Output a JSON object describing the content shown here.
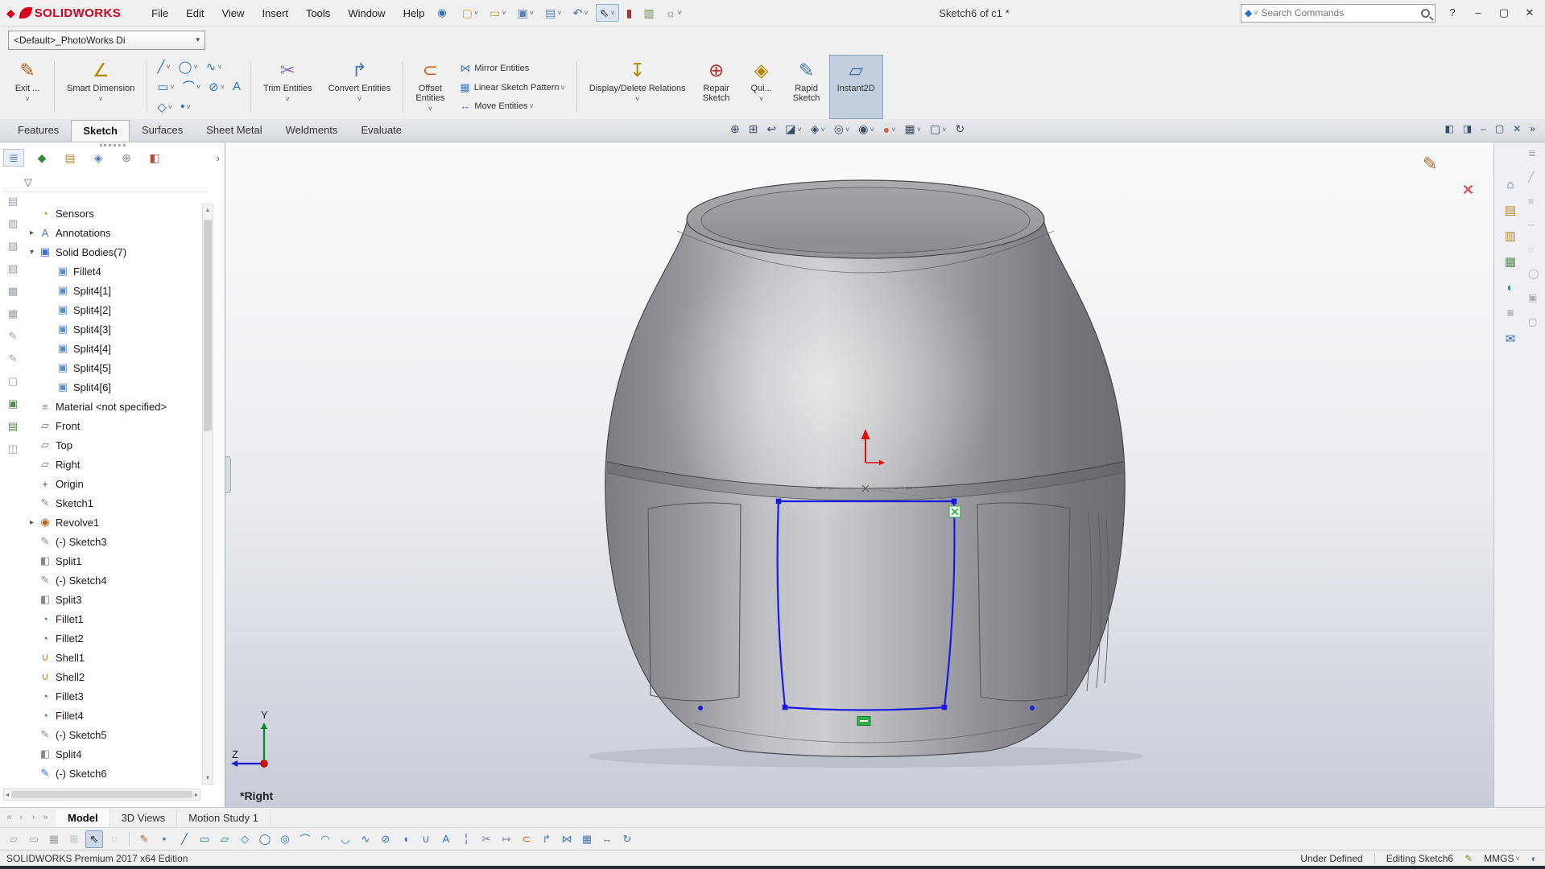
{
  "ui": {
    "caret": "▾",
    "caret_small": "˅",
    "tree_expanded": "▾",
    "tree_collapsed": "▸",
    "scroll_up": "▴",
    "scroll_down": "▾",
    "scroll_left": "◂",
    "scroll_right": "▸",
    "panel_chevron": "›"
  },
  "colors": {
    "logo_red": "#d6001c",
    "sketch_blue": "#1a1ae0",
    "relation_green": "#2fae4a",
    "axis_red": "#e01010",
    "triad_green": "#00882a",
    "triad_blue": "#1a1ad0",
    "active_button_bg": "#c3cfdf",
    "chrome_bg": "#f0f0f0"
  },
  "titlebar": {
    "app_icon": {
      "glyph": "◆",
      "color": "#d6001c"
    },
    "logo_text": "SOLIDWORKS",
    "menus": [
      "File",
      "Edit",
      "View",
      "Insert",
      "Tools",
      "Window",
      "Help"
    ],
    "pin_icon": {
      "glyph": "◉",
      "color": "#2a6fc0"
    },
    "quick_access": [
      {
        "name": "new-document",
        "icon": {
          "glyph": "▢",
          "color": "#c8a23c"
        },
        "caret": true
      },
      {
        "name": "open",
        "icon": {
          "glyph": "▭",
          "color": "#c8a23c"
        },
        "caret": true
      },
      {
        "name": "save",
        "icon": {
          "glyph": "▣",
          "color": "#5b7fae"
        },
        "caret": true
      },
      {
        "name": "print",
        "icon": {
          "glyph": "▤",
          "color": "#5b7fae"
        },
        "caret": true
      },
      {
        "name": "undo",
        "icon": {
          "glyph": "↶",
          "color": "#3a6eb5"
        },
        "caret": true
      },
      {
        "name": "select",
        "icon": {
          "glyph": "⇖",
          "color": "#333333"
        },
        "caret": true,
        "active": true
      },
      {
        "name": "rebuild",
        "icon": {
          "glyph": "▮",
          "color": "#b03030"
        }
      },
      {
        "name": "file-properties",
        "icon": {
          "glyph": "▥",
          "color": "#6a8a4a"
        }
      },
      {
        "name": "options",
        "icon": {
          "glyph": "☼",
          "color": "#777777"
        },
        "caret": true
      }
    ],
    "document_title": "Sketch6 of c1 *",
    "search": {
      "selector_icon": {
        "glyph": "◆",
        "color": "#2a6fc0"
      },
      "placeholder": "Search Commands"
    },
    "window_controls": [
      {
        "name": "help",
        "glyph": "?"
      },
      {
        "name": "minimize",
        "glyph": "–"
      },
      {
        "name": "maximize",
        "glyph": "▢"
      },
      {
        "name": "close",
        "glyph": "✕"
      }
    ]
  },
  "config_bar": {
    "value": "<Default>_PhotoWorks Di"
  },
  "ribbon": {
    "tabs": [
      {
        "label": "Features"
      },
      {
        "label": "Sketch",
        "active": true
      },
      {
        "label": "Surfaces"
      },
      {
        "label": "Sheet Metal"
      },
      {
        "label": "Weldments"
      },
      {
        "label": "Evaluate"
      }
    ],
    "exit_sketch": {
      "label": "Exit ...",
      "icon": {
        "glyph": "✎",
        "color": "#b5651d"
      }
    },
    "smart_dimension": {
      "label": "Smart Dimension",
      "icon": {
        "glyph": "∠",
        "color": "#b08800"
      }
    },
    "sketch_tools_grid": [
      [
        {
          "name": "line",
          "glyph": "╱",
          "caret": true
        },
        {
          "name": "circle",
          "glyph": "◯",
          "caret": true
        },
        {
          "name": "spline",
          "glyph": "∿",
          "caret": true
        }
      ],
      [
        {
          "name": "corner-rectangle",
          "glyph": "▭",
          "caret": true
        },
        {
          "name": "centerpoint-arc",
          "glyph": "⌒",
          "caret": true
        },
        {
          "name": "ellipse",
          "glyph": "⊘",
          "caret": true
        },
        {
          "name": "text",
          "glyph": "A"
        }
      ],
      [
        {
          "name": "polygon",
          "glyph": "◇",
          "caret": true
        },
        {
          "name": "point",
          "glyph": "•",
          "caret": true
        }
      ]
    ],
    "trim_entities": {
      "label": "Trim Entities",
      "icon": {
        "glyph": "✂",
        "color": "#8a6db0"
      }
    },
    "convert_entities": {
      "label": "Convert Entities",
      "icon": {
        "glyph": "↱",
        "color": "#4a7ab5"
      }
    },
    "offset_entities": {
      "label": "Offset\nEntities",
      "icon": {
        "glyph": "⊂",
        "color": "#d2691e"
      }
    },
    "mirror_entities": {
      "label": "Mirror Entities",
      "icon": {
        "glyph": "⋈",
        "color": "#4a7ab5"
      }
    },
    "linear_pattern": {
      "label": "Linear Sketch Pattern",
      "icon": {
        "glyph": "▦",
        "color": "#4a7ab5"
      },
      "caret": true
    },
    "move_entities": {
      "label": "Move Entities",
      "icon": {
        "glyph": "↔",
        "color": "#4a7ab5"
      },
      "caret": true
    },
    "display_delete_relations": {
      "label": "Display/Delete Relations",
      "icon": {
        "glyph": "↧",
        "color": "#b08800"
      }
    },
    "repair_sketch": {
      "label": "Repair\nSketch",
      "icon": {
        "glyph": "⊕",
        "color": "#b03030"
      }
    },
    "quick_snaps": {
      "label": "Qui...",
      "icon": {
        "glyph": "◈",
        "color": "#b08800"
      }
    },
    "rapid_sketch": {
      "label": "Rapid\nSketch",
      "icon": {
        "glyph": "✎",
        "color": "#4a7ab5"
      }
    },
    "instant2d": {
      "label": "Instant2D",
      "icon": {
        "glyph": "▱",
        "color": "#3a6a9a"
      },
      "active": true
    }
  },
  "headsup": [
    {
      "name": "zoom-to-fit",
      "glyph": "⊕"
    },
    {
      "name": "zoom-to-area",
      "glyph": "⊞"
    },
    {
      "name": "previous-view",
      "glyph": "↩"
    },
    {
      "name": "section-view",
      "glyph": "◪",
      "caret": true
    },
    {
      "name": "view-orientation",
      "glyph": "◈",
      "caret": true
    },
    {
      "name": "display-style",
      "glyph": "◎",
      "caret": true
    },
    {
      "name": "hide-show-items",
      "glyph": "◉",
      "caret": true
    },
    {
      "name": "edit-appearance",
      "glyph": "●",
      "color": "#c86a3a",
      "caret": true
    },
    {
      "name": "apply-scene",
      "glyph": "▦",
      "caret": true
    },
    {
      "name": "view-settings",
      "glyph": "▢",
      "caret": true
    },
    {
      "name": "rotate-view",
      "glyph": "↻"
    }
  ],
  "doc_window_controls": [
    {
      "name": "display-pane-toggle",
      "glyph": "◧"
    },
    {
      "name": "fullscreen-toggle",
      "glyph": "◨"
    },
    {
      "name": "doc-minimize",
      "glyph": "–"
    },
    {
      "name": "doc-restore",
      "glyph": "▢"
    },
    {
      "name": "doc-close",
      "glyph": "✕"
    },
    {
      "name": "doc-tabs-overflow",
      "glyph": "»"
    }
  ],
  "feature_tree": {
    "filter_icon": {
      "glyph": "▽",
      "color": "#666666"
    },
    "panel_tabs": [
      {
        "name": "featuremanager-tab",
        "glyph": "≣",
        "color": "#4a7ab5",
        "active": true
      },
      {
        "name": "propertymanager-tab",
        "glyph": "◆",
        "color": "#3a8a3a"
      },
      {
        "name": "configurationmanager-tab",
        "glyph": "▤",
        "color": "#b5882a"
      },
      {
        "name": "dimxpertmanager-tab",
        "glyph": "◈",
        "color": "#4a7ab5"
      },
      {
        "name": "displaymanager-tab",
        "glyph": "⊕",
        "color": "#8a8a8a"
      },
      {
        "name": "scene-tab",
        "glyph": "◧",
        "color": "#c04a3a"
      }
    ],
    "icon_styles": {
      "sensors": {
        "glyph": "◔",
        "color": "#b5882a"
      },
      "annotations": {
        "glyph": "A",
        "color": "#4a7ab5"
      },
      "solid-bodies": {
        "glyph": "▣",
        "color": "#3a6ed0"
      },
      "body": {
        "glyph": "▣",
        "color": "#5b8bd0"
      },
      "material": {
        "glyph": "≡",
        "color": "#888888"
      },
      "plane": {
        "glyph": "▱",
        "color": "#708090"
      },
      "origin": {
        "glyph": "+",
        "color": "#555555"
      },
      "sketch": {
        "glyph": "✎",
        "color": "#8a8a8a"
      },
      "sketch-active": {
        "glyph": "✎",
        "color": "#2a6fc0"
      },
      "revolve": {
        "glyph": "◉",
        "color": "#b5651d"
      },
      "split": {
        "glyph": "◧",
        "color": "#888888"
      },
      "fillet": {
        "glyph": "◔",
        "color": "#3a6ed0"
      },
      "shell": {
        "glyph": "∪",
        "color": "#b5882a"
      }
    },
    "items": [
      {
        "label": "Sensors",
        "icon": "sensors",
        "indent": 0
      },
      {
        "label": "Annotations",
        "icon": "annotations",
        "indent": 0,
        "expand": "collapsed"
      },
      {
        "label": "Solid Bodies(7)",
        "icon": "solid-bodies",
        "indent": 0,
        "expand": "expanded"
      },
      {
        "label": "Fillet4",
        "icon": "body",
        "indent": 1
      },
      {
        "label": "Split4[1]",
        "icon": "body",
        "indent": 1
      },
      {
        "label": "Split4[2]",
        "icon": "body",
        "indent": 1
      },
      {
        "label": "Split4[3]",
        "icon": "body",
        "indent": 1
      },
      {
        "label": "Split4[4]",
        "icon": "body",
        "indent": 1
      },
      {
        "label": "Split4[5]",
        "icon": "body",
        "indent": 1
      },
      {
        "label": "Split4[6]",
        "icon": "body",
        "indent": 1
      },
      {
        "label": "Material <not specified>",
        "icon": "material",
        "indent": 0
      },
      {
        "label": "Front",
        "icon": "plane",
        "indent": 0
      },
      {
        "label": "Top",
        "icon": "plane",
        "indent": 0
      },
      {
        "label": "Right",
        "icon": "plane",
        "indent": 0
      },
      {
        "label": "Origin",
        "icon": "origin",
        "indent": 0
      },
      {
        "label": "Sketch1",
        "icon": "sketch",
        "indent": 0
      },
      {
        "label": "Revolve1",
        "icon": "revolve",
        "indent": 0,
        "expand": "collapsed"
      },
      {
        "label": "(-) Sketch3",
        "icon": "sketch",
        "indent": 0
      },
      {
        "label": "Split1",
        "icon": "split",
        "indent": 0
      },
      {
        "label": "(-) Sketch4",
        "icon": "sketch",
        "indent": 0
      },
      {
        "label": "Split3",
        "icon": "split",
        "indent": 0
      },
      {
        "label": "Fillet1",
        "icon": "fillet",
        "indent": 0
      },
      {
        "label": "Fillet2",
        "icon": "fillet",
        "indent": 0
      },
      {
        "label": "Shell1",
        "icon": "shell",
        "indent": 0
      },
      {
        "label": "Shell2",
        "icon": "shell",
        "indent": 0
      },
      {
        "label": "Fillet3",
        "icon": "fillet",
        "indent": 0
      },
      {
        "label": "Fillet4",
        "icon": "fillet",
        "indent": 0
      },
      {
        "label": "(-) Sketch5",
        "icon": "sketch",
        "indent": 0
      },
      {
        "label": "Split4",
        "icon": "split",
        "indent": 0
      },
      {
        "label": "(-) Sketch6",
        "icon": "sketch-active",
        "indent": 0
      }
    ]
  },
  "left_rail": [
    {
      "name": "hide-tree",
      "glyph": "▤"
    },
    {
      "name": "roll-back",
      "glyph": "▥"
    },
    {
      "name": "copy-item",
      "glyph": "▧"
    },
    {
      "name": "paste-item",
      "glyph": "▨"
    },
    {
      "name": "suppress",
      "glyph": "▩"
    },
    {
      "name": "unsuppress",
      "glyph": "▦"
    },
    {
      "name": "edit-part",
      "glyph": "✎"
    },
    {
      "name": "edit-sketch-tool",
      "glyph": "✎"
    },
    {
      "name": "display-states",
      "glyph": "▢"
    },
    {
      "name": "appearance-copy",
      "glyph": "▣",
      "color": "#4a8a4a"
    },
    {
      "name": "appearance-paste",
      "glyph": "▤",
      "color": "#4a8a4a"
    },
    {
      "name": "isolate",
      "glyph": "◫"
    }
  ],
  "task_pane": [
    {
      "name": "home",
      "glyph": "⌂",
      "color": "#3a6eb5"
    },
    {
      "name": "design-library",
      "glyph": "▤",
      "color": "#b5882a"
    },
    {
      "name": "file-explorer",
      "glyph": "▥",
      "color": "#b5882a"
    },
    {
      "name": "view-palette",
      "glyph": "▦",
      "color": "#5a8a5a"
    },
    {
      "name": "appearances",
      "glyph": "◐",
      "color": "#2a8ab5"
    },
    {
      "name": "custom-properties",
      "glyph": "≡",
      "color": "#888888"
    },
    {
      "name": "forum",
      "glyph": "✉",
      "color": "#3a6eb5"
    }
  ],
  "right_edge_toolbar": [
    {
      "name": "layer-properties",
      "glyph": "≣"
    },
    {
      "name": "edit-line-color",
      "glyph": "╱"
    },
    {
      "name": "line-thickness",
      "glyph": "≡"
    },
    {
      "name": "line-style",
      "glyph": "┄"
    },
    {
      "name": "hide-edge",
      "glyph": "◌"
    },
    {
      "name": "show-edge",
      "glyph": "◯"
    },
    {
      "name": "color-display-mode",
      "glyph": "▣"
    },
    {
      "name": "set-layer",
      "glyph": "▢"
    }
  ],
  "viewport": {
    "orientation_label": "*Right",
    "triad": {
      "y_label": "Y",
      "z_label": "Z"
    },
    "confirmation_corner": {
      "exit_icon": {
        "glyph": "✎",
        "color": "#b5651d"
      },
      "cancel_icon": {
        "glyph": "✕",
        "color": "#e05560"
      }
    }
  },
  "bottom_bar": {
    "nav_buttons": [
      {
        "name": "first-tab",
        "glyph": "«"
      },
      {
        "name": "prev-tab",
        "glyph": "‹"
      },
      {
        "name": "next-tab",
        "glyph": "›"
      },
      {
        "name": "last-tab",
        "glyph": "»"
      }
    ],
    "tabs": [
      {
        "label": "Model",
        "active": true
      },
      {
        "label": "3D Views"
      },
      {
        "label": "Motion Study 1"
      }
    ]
  },
  "sketch_toolbar": [
    {
      "name": "select-chain",
      "glyph": "▱",
      "disabled": true
    },
    {
      "name": "select-box",
      "glyph": "▭",
      "disabled": true
    },
    {
      "name": "grid-settings",
      "glyph": "▦",
      "disabled": true
    },
    {
      "name": "snap-to-points",
      "glyph": "⊞",
      "color": "#4a8a4a",
      "disabled": true
    },
    {
      "name": "select",
      "glyph": "⇖",
      "active": true
    },
    {
      "name": "lasso-select",
      "glyph": "◌",
      "disabled": true
    },
    {
      "sep": true
    },
    {
      "name": "sketch",
      "glyph": "✎",
      "color": "#b5651d"
    },
    {
      "name": "point",
      "glyph": "•",
      "color": "#2a6fc0"
    },
    {
      "name": "line",
      "glyph": "╱",
      "color": "#2a6fc0"
    },
    {
      "name": "corner-rectangle",
      "glyph": "▭",
      "color": "#2a6fc0"
    },
    {
      "name": "parallelogram",
      "glyph": "▱",
      "color": "#2a6fc0"
    },
    {
      "name": "polygon",
      "glyph": "◇",
      "color": "#2a6fc0"
    },
    {
      "name": "circle",
      "glyph": "◯",
      "color": "#2a6fc0"
    },
    {
      "name": "perimeter-circle",
      "glyph": "◎",
      "color": "#2a6fc0"
    },
    {
      "name": "centerpoint-arc",
      "glyph": "⌒",
      "color": "#2a6fc0"
    },
    {
      "name": "tangent-arc",
      "glyph": "◠",
      "color": "#2a6fc0"
    },
    {
      "name": "three-point-arc",
      "glyph": "◡",
      "color": "#2a6fc0"
    },
    {
      "name": "spline",
      "glyph": "∿",
      "color": "#2a6fc0"
    },
    {
      "name": "ellipse",
      "glyph": "⊘",
      "color": "#2a6fc0"
    },
    {
      "name": "partial-ellipse",
      "glyph": "◖",
      "color": "#2a6fc0"
    },
    {
      "name": "parabola",
      "glyph": "∪",
      "color": "#2a6fc0"
    },
    {
      "name": "text",
      "glyph": "A",
      "color": "#2a6fc0"
    },
    {
      "name": "centerline",
      "glyph": "╎",
      "color": "#2a6fc0"
    },
    {
      "name": "trim-entities",
      "glyph": "✂",
      "color": "#8a6db0"
    },
    {
      "name": "extend-entities",
      "glyph": "↦",
      "color": "#8a6db0"
    },
    {
      "name": "offset-entities",
      "glyph": "⊂",
      "color": "#d2691e"
    },
    {
      "name": "convert-entities",
      "glyph": "↱",
      "color": "#4a7ab5"
    },
    {
      "name": "mirror-entities",
      "glyph": "⋈",
      "color": "#4a7ab5"
    },
    {
      "name": "linear-sketch-pattern",
      "glyph": "▦",
      "color": "#4a7ab5"
    },
    {
      "name": "move-entities",
      "glyph": "↔",
      "color": "#4a7ab5"
    },
    {
      "name": "rotate-entities",
      "glyph": "↻",
      "color": "#4a7ab5"
    }
  ],
  "status_bar": {
    "left_text": "SOLIDWORKS Premium 2017 x64 Edition",
    "constraint_status": "Under Defined",
    "editing_status": "Editing Sketch6",
    "pen_icon": {
      "glyph": "✎",
      "color": "#8a8a3a"
    },
    "units": "MMGS",
    "globe_icon": {
      "glyph": "◐",
      "color": "#3a7ab5"
    }
  }
}
